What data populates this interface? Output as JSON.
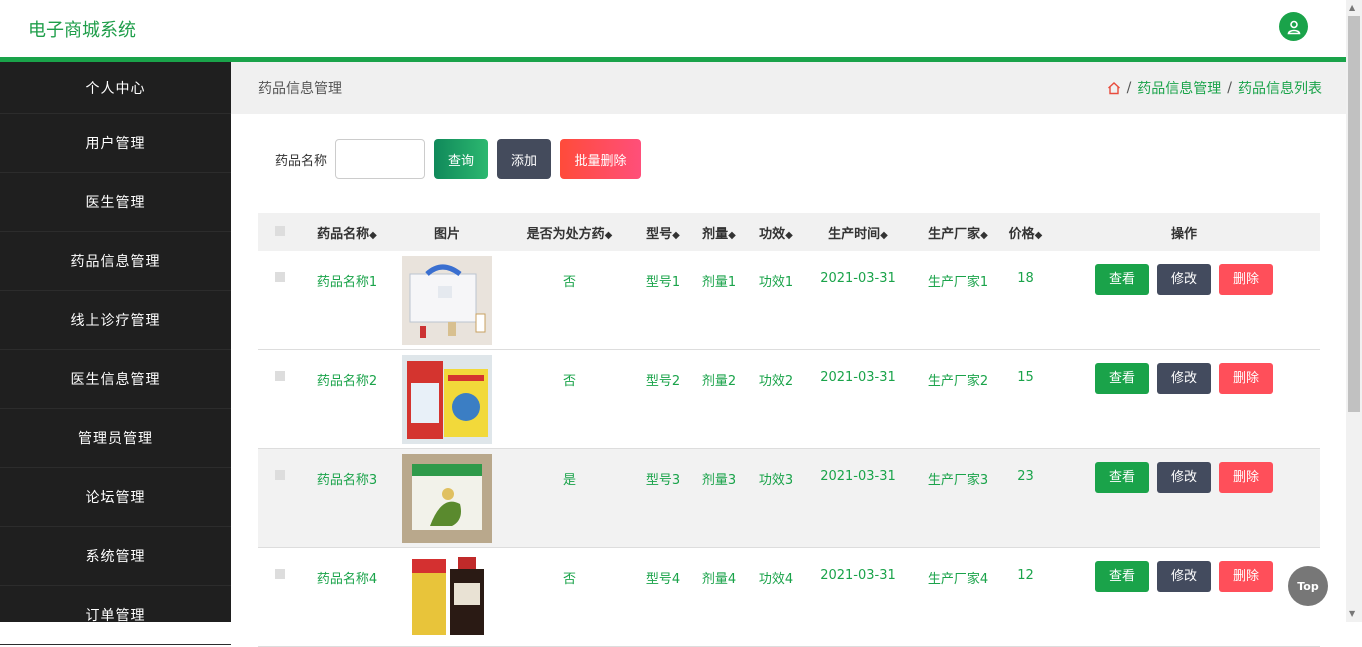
{
  "header": {
    "title": "电子商城系统",
    "avatar_icon": "user-icon"
  },
  "sidebar": {
    "items": [
      {
        "label": "个人中心"
      },
      {
        "label": "用户管理"
      },
      {
        "label": "医生管理"
      },
      {
        "label": "药品信息管理"
      },
      {
        "label": "线上诊疗管理"
      },
      {
        "label": "医生信息管理"
      },
      {
        "label": "管理员管理"
      },
      {
        "label": "论坛管理"
      },
      {
        "label": "系统管理"
      },
      {
        "label": "订单管理"
      }
    ]
  },
  "breadcrumb": {
    "page_title": "药品信息管理",
    "items": [
      "药品信息管理",
      "药品信息列表"
    ],
    "separator": "/"
  },
  "search": {
    "label": "药品名称",
    "value": "",
    "query_label": "查询",
    "add_label": "添加",
    "batch_delete_label": "批量删除"
  },
  "table": {
    "columns": [
      "药品名称",
      "图片",
      "是否为处方药",
      "型号",
      "剂量",
      "功效",
      "生产时间",
      "生产厂家",
      "价格",
      "操作"
    ],
    "rows": [
      {
        "name": "药品名称1",
        "rx": "否",
        "model": "型号1",
        "dose": "剂量1",
        "effect": "功效1",
        "time": "2021-03-31",
        "maker": "生产厂家1",
        "price": "18"
      },
      {
        "name": "药品名称2",
        "rx": "否",
        "model": "型号2",
        "dose": "剂量2",
        "effect": "功效2",
        "time": "2021-03-31",
        "maker": "生产厂家2",
        "price": "15"
      },
      {
        "name": "药品名称3",
        "rx": "是",
        "model": "型号3",
        "dose": "剂量3",
        "effect": "功效3",
        "time": "2021-03-31",
        "maker": "生产厂家3",
        "price": "23"
      },
      {
        "name": "药品名称4",
        "rx": "否",
        "model": "型号4",
        "dose": "剂量4",
        "effect": "功效4",
        "time": "2021-03-31",
        "maker": "生产厂家4",
        "price": "12"
      }
    ],
    "ops": {
      "view": "查看",
      "edit": "修改",
      "delete": "删除"
    }
  },
  "top_button": "Top",
  "colors": {
    "accent": "#1aa34a",
    "sidebar": "#1f1f1f",
    "danger": "#ff4f5a",
    "dark_button": "#434b5e"
  }
}
